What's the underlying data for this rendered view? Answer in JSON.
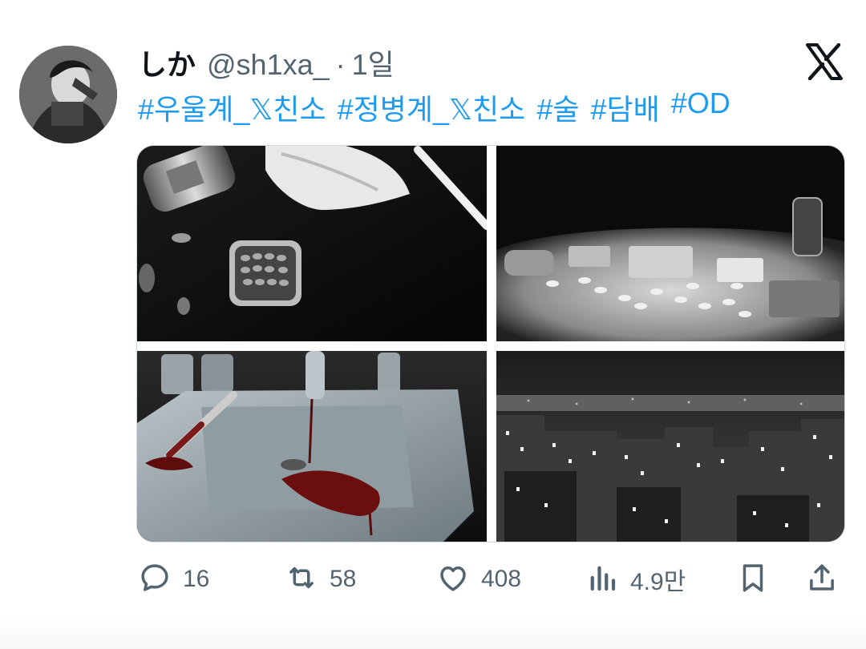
{
  "tweet": {
    "display_name": "しか",
    "handle": "@sh1xa_",
    "separator": "·",
    "time": "1일",
    "hashtags": [
      "#우울계_𝕏친소",
      "#정병계_𝕏친소",
      "#술",
      "#담배",
      "#OD"
    ],
    "media": [
      {
        "name": "pills-cigarette-image"
      },
      {
        "name": "pills-on-table-image"
      },
      {
        "name": "bloody-sink-image"
      },
      {
        "name": "night-city-image"
      }
    ],
    "actions": {
      "replies": "16",
      "retweets": "58",
      "likes": "408",
      "views": "4.9만"
    }
  },
  "colors": {
    "link": "#1d9bf0",
    "secondary_text": "#536471",
    "primary_text": "#0f1419"
  },
  "icons": [
    "x-logo-icon",
    "reply-icon",
    "retweet-icon",
    "like-icon",
    "views-icon",
    "bookmark-icon",
    "share-icon"
  ]
}
